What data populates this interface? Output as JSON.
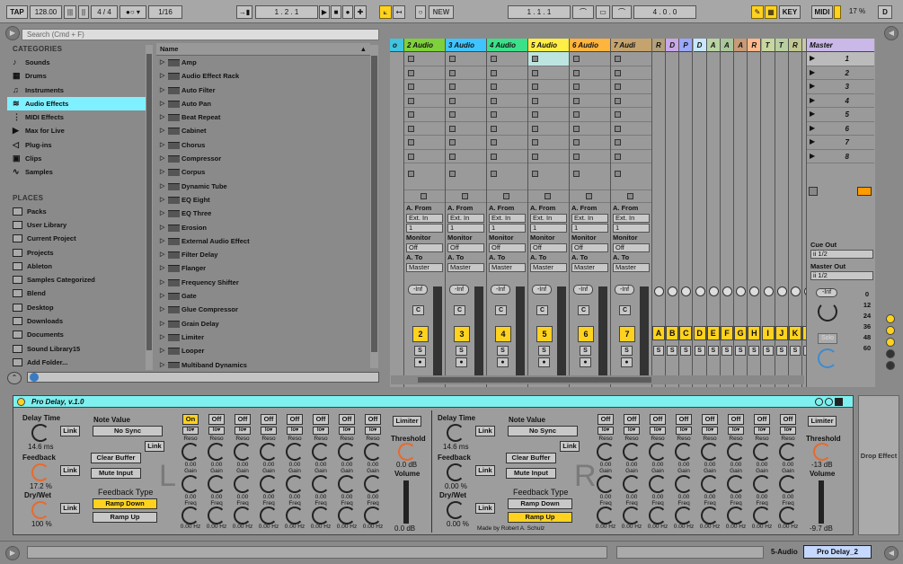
{
  "transport": {
    "tap": "TAP",
    "tempo": "128.00",
    "sig": "4 / 4",
    "quant": "1/16",
    "pos": "1 .   2 .   1",
    "new": "NEW",
    "loop_start": "1 .   1 .   1",
    "loop_len": "4 .   0 .   0",
    "key": "KEY",
    "midi": "MIDI",
    "cpu": "17 %",
    "d": "D"
  },
  "browser": {
    "search_placeholder": "Search (Cmd + F)",
    "categories_title": "CATEGORIES",
    "places_title": "PLACES",
    "name_col": "Name",
    "categories": [
      "Sounds",
      "Drums",
      "Instruments",
      "Audio Effects",
      "MIDI Effects",
      "Max for Live",
      "Plug-ins",
      "Clips",
      "Samples"
    ],
    "category_icons": [
      "note-icon",
      "grid-icon",
      "instrument-icon",
      "effect-icon",
      "midi-effect-icon",
      "max-icon",
      "plugin-icon",
      "clip-icon",
      "wave-icon"
    ],
    "places": [
      "Packs",
      "User Library",
      "Current Project",
      "Projects",
      "Ableton",
      "Samples Categorized",
      "Blend",
      "Desktop",
      "Downloads",
      "Documents",
      "Sound Library15",
      "Add Folder..."
    ],
    "items": [
      "Amp",
      "Audio Effect Rack",
      "Auto Filter",
      "Auto Pan",
      "Beat Repeat",
      "Cabinet",
      "Chorus",
      "Compressor",
      "Corpus",
      "Dynamic Tube",
      "EQ Eight",
      "EQ Three",
      "Erosion",
      "External Audio Effect",
      "Filter Delay",
      "Flanger",
      "Frequency Shifter",
      "Gate",
      "Glue Compressor",
      "Grain Delay",
      "Limiter",
      "Looper",
      "Multiband Dynamics"
    ]
  },
  "tracks": [
    {
      "name": "2 Audio",
      "color": "#7fd13b",
      "num": "2"
    },
    {
      "name": "3 Audio",
      "color": "#40c4ff",
      "num": "3"
    },
    {
      "name": "4 Audio",
      "color": "#3ce08a",
      "num": "4"
    },
    {
      "name": "5 Audio",
      "color": "#ffee45",
      "num": "5"
    },
    {
      "name": "6 Audio",
      "color": "#ffb43d",
      "num": "6"
    },
    {
      "name": "7 Audi",
      "color": "#c4a36e",
      "num": "7"
    }
  ],
  "mini_tracks": [
    {
      "l": "R",
      "c": "#b1a07a",
      "n": "A"
    },
    {
      "l": "D",
      "c": "#c9a8e8",
      "n": "B"
    },
    {
      "l": "P",
      "c": "#9aa8ff",
      "n": "C"
    },
    {
      "l": "D",
      "c": "#c7e8ff",
      "n": "D"
    },
    {
      "l": "A",
      "c": "#b9d3a3",
      "n": "E"
    },
    {
      "l": "A",
      "c": "#a9c79a",
      "n": "F"
    },
    {
      "l": "A",
      "c": "#c89a77",
      "n": "G"
    },
    {
      "l": "R",
      "c": "#ffb98a",
      "n": "H"
    },
    {
      "l": "T",
      "c": "#c8d6a0",
      "n": "I"
    },
    {
      "l": "T",
      "c": "#b8cfa0",
      "n": "J"
    },
    {
      "l": "R",
      "c": "#c1c790",
      "n": "K"
    },
    {
      "l": "R",
      "c": "#c8c8a8",
      "n": "L"
    }
  ],
  "io": {
    "from": "A. From",
    "ext": "Ext. In",
    "one": "1",
    "monitor": "Monitor",
    "off": "Off",
    "to": "A. To",
    "master": "Master",
    "inf": "-Inf",
    "c": "C",
    "s": "S"
  },
  "master": {
    "name": "Master",
    "scenes": [
      "1",
      "2",
      "3",
      "4",
      "5",
      "6",
      "7",
      "8"
    ],
    "cue_label": "Cue Out",
    "cue": "ii 1/2",
    "out_label": "Master Out",
    "out": "ii 1/2",
    "inf": "-Inf",
    "solo": "Solo",
    "db": [
      "0",
      "12",
      "24",
      "36",
      "48",
      "60"
    ]
  },
  "device": {
    "title": "Pro Delay, v.1.0",
    "delay_time": "Delay Time",
    "delay_val": "14.6 ms",
    "link": "Link",
    "note_value": "Note Value",
    "no_sync": "No Sync",
    "feedback": "Feedback",
    "fb_val": "17.2 %",
    "fb_val_r": "0.00 %",
    "drywet": "Dry/Wet",
    "dw_val": "100 %",
    "dw_val_r": "0.00 %",
    "clear": "Clear Buffer",
    "mute": "Mute Input",
    "fbtype": "Feedback Type",
    "ramp_down": "Ramp Down",
    "ramp_up": "Ramp Up",
    "limiter": "Limiter",
    "threshold": "Threshold",
    "thr_val": "0.0 dB",
    "thr_val_r": "-13 dB",
    "volume": "Volume",
    "vol_val": "0.0 dB",
    "vol_val_r": "-9.7 dB",
    "on": "On",
    "off": "Off",
    "reso": "Reso",
    "gain": "Gain",
    "freq": "Freq",
    "zero": "0.00",
    "hz": "0.00 Hz",
    "left": "L",
    "right": "R",
    "made": "Made by Robert A. Schulz"
  },
  "drop": "Drop Effect",
  "status": {
    "track": "5-Audio",
    "device": "Pro Delay_2"
  }
}
